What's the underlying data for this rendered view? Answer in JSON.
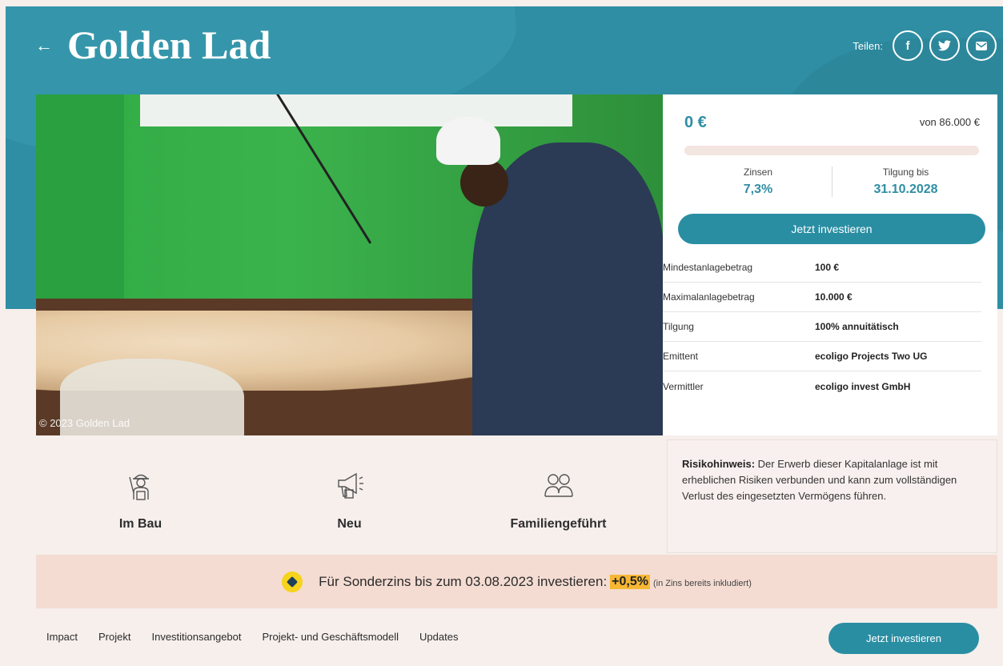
{
  "header": {
    "back_label": "←",
    "title": "Golden Lad",
    "share_label": "Teilen:",
    "share_icons": [
      "facebook-icon",
      "twitter-icon",
      "mail-icon"
    ],
    "share_glyphs": [
      "f",
      "🐦",
      "✉"
    ]
  },
  "photo": {
    "credit": "© 2023 Golden Lad"
  },
  "invest_card": {
    "amount": "0 €",
    "target": "von 86.000 €",
    "progress_fraction": 0,
    "interest_label": "Zinsen",
    "interest_value": "7,3%",
    "repayment_label": "Tilgung bis",
    "repayment_value": "31.10.2028",
    "invest_button": "Jetzt investieren",
    "facts": [
      {
        "label": "Mindestanlagebetrag",
        "value": "100 €"
      },
      {
        "label": "Maximalanlagebetrag",
        "value": "10.000 €"
      },
      {
        "label": "Tilgung",
        "value": "100% annuitätisch"
      },
      {
        "label": "Emittent",
        "value": "ecoligo Projects Two UG"
      },
      {
        "label": "Vermittler",
        "value": "ecoligo invest GmbH"
      }
    ]
  },
  "features": [
    {
      "icon": "construction-worker-icon",
      "label": "Im Bau"
    },
    {
      "icon": "megaphone-icon",
      "label": "Neu"
    },
    {
      "icon": "family-icon",
      "label": "Familiengeführt"
    }
  ],
  "risk": {
    "title": "Risikohinweis:",
    "text": " Der Erwerb dieser Kapitalanlage ist mit erheblichen Risiken verbunden und kann zum vollständigen Verlust des eingesetzten Vermögens führen."
  },
  "promo": {
    "icon": "tag-icon",
    "text": "Für Sonderzins bis zum 03.08.2023 investieren:",
    "rate": "+0,5%",
    "note": "(in Zins bereits inkludiert)"
  },
  "bottom_nav": {
    "items": [
      "Impact",
      "Projekt",
      "Investitionsangebot",
      "Projekt- und Geschäftsmodell",
      "Updates"
    ],
    "invest_button": "Jetzt investieren"
  },
  "colors": {
    "brand": "#2f8ea3",
    "promo_bg": "#f4dcd2",
    "highlight": "#f7b733"
  }
}
